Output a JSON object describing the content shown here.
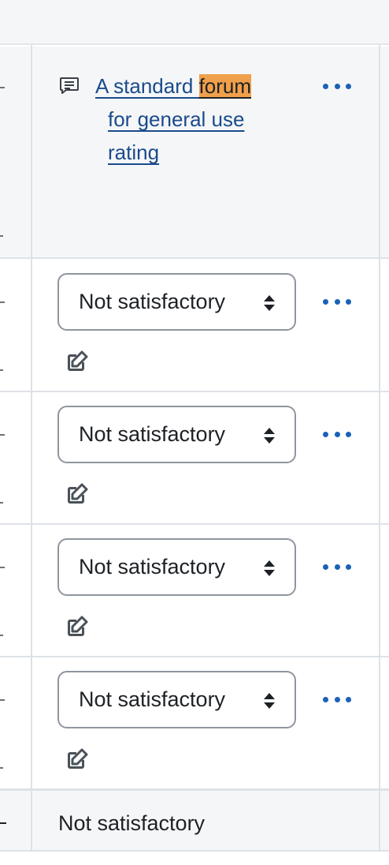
{
  "header": {
    "forum_link": {
      "line1_prefix": "A standard ",
      "line1_highlight": "forum",
      "line2": "for general use",
      "line3": "rating"
    },
    "icon": "forum-discussion-icon",
    "actions_icon": "more-actions-icon"
  },
  "rows": [
    {
      "grade_value": "Not satisfactory",
      "edit_icon": "edit-feedback-icon",
      "actions_icon": "more-actions-icon"
    },
    {
      "grade_value": "Not satisfactory",
      "edit_icon": "edit-feedback-icon",
      "actions_icon": "more-actions-icon"
    },
    {
      "grade_value": "Not satisfactory",
      "edit_icon": "edit-feedback-icon",
      "actions_icon": "more-actions-icon"
    },
    {
      "grade_value": "Not satisfactory",
      "edit_icon": "edit-feedback-icon",
      "actions_icon": "more-actions-icon"
    }
  ],
  "footer": {
    "overall_value": "Not satisfactory"
  },
  "colors": {
    "link": "#1a4b8c",
    "highlight": "#f0a04b",
    "action_dots": "#1a62b8",
    "header_bg": "#f5f6f8",
    "border": "#dee2e6"
  }
}
